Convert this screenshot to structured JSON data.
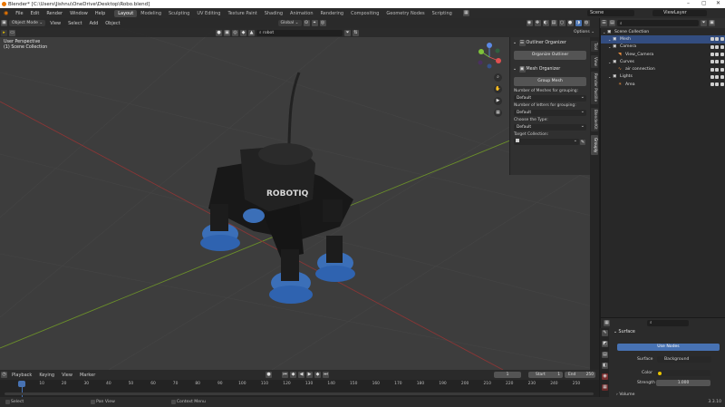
{
  "titlebar": {
    "title": "Blender* [C:\\Users\\Jishnu\\OneDrive\\Desktop\\Robo.blend]"
  },
  "menu": {
    "items": [
      "File",
      "Edit",
      "Render",
      "Window",
      "Help"
    ]
  },
  "workspaces": [
    "Layout",
    "Modeling",
    "Sculpting",
    "UV Editing",
    "Texture Paint",
    "Shading",
    "Animation",
    "Rendering",
    "Compositing",
    "Geometry Nodes",
    "Scripting"
  ],
  "active_workspace": "Layout",
  "scene": {
    "label": "Scene",
    "view_layer": "ViewLayer"
  },
  "viewport": {
    "mode": "Object Mode",
    "menus": [
      "View",
      "Select",
      "Add",
      "Object"
    ],
    "orientation": "Global",
    "search_value": "robot",
    "options_label": "Options",
    "overlay_line1": "User Perspective",
    "overlay_line2": "(1) Scene Collection",
    "robot_logo": "ROBOTIQ"
  },
  "side_tabs": [
    "Tool",
    "View",
    "Render Pastille",
    "BlenderKit",
    "Grouply"
  ],
  "npanel": {
    "outliner_header": "Outliner Organizer",
    "organize_button": "Organize Outliner",
    "mesh_header": "Mesh Organizer",
    "group_button": "Group Mesh",
    "meshes_label": "Number of Meshes for grouping:",
    "meshes_value": "Default",
    "letters_label": "Number of letters for grouping:",
    "letters_value": "Default",
    "type_label": "Choose the Type:",
    "type_value": "Default",
    "target_label": "Target Collection:"
  },
  "outliner": {
    "rows": [
      {
        "label": "Scene Collection",
        "indent": 0,
        "selected": false,
        "vis": false
      },
      {
        "label": "Mesh",
        "indent": 1,
        "selected": true,
        "vis": true
      },
      {
        "label": "Camera",
        "indent": 1,
        "selected": false,
        "vis": true
      },
      {
        "label": "View_Camera",
        "indent": 2,
        "selected": false,
        "vis": true
      },
      {
        "label": "Curves",
        "indent": 1,
        "selected": false,
        "vis": true
      },
      {
        "label": "air connection",
        "indent": 2,
        "selected": false,
        "vis": true
      },
      {
        "label": "Lights",
        "indent": 1,
        "selected": false,
        "vis": true
      },
      {
        "label": "Area",
        "indent": 2,
        "selected": false,
        "vis": true
      }
    ]
  },
  "properties": {
    "section": "Surface",
    "use_nodes": "Use Nodes",
    "surface_label": "Surface",
    "surface_value": "Background",
    "color_label": "Color",
    "strength_label": "Strength",
    "strength_value": "1.000",
    "volume_label": "Volume"
  },
  "timeline": {
    "menus": [
      "Playback",
      "Keying",
      "View",
      "Marker"
    ],
    "current_frame": "1",
    "start_label": "Start",
    "start_value": "1",
    "end_label": "End",
    "end_value": "250",
    "ticks": [
      "1",
      "10",
      "20",
      "30",
      "40",
      "50",
      "60",
      "70",
      "80",
      "90",
      "100",
      "110",
      "120",
      "130",
      "140",
      "150",
      "160",
      "170",
      "180",
      "190",
      "200",
      "210",
      "220",
      "230",
      "240",
      "250"
    ]
  },
  "statusbar": {
    "select": "Select",
    "pan": "Pan View",
    "context": "Context Menu",
    "version": "3.3.10"
  }
}
